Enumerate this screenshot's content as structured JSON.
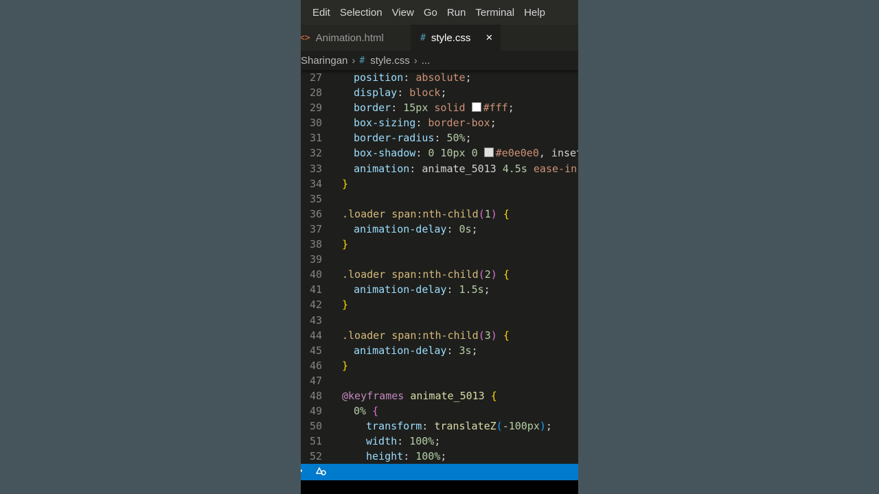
{
  "menu": [
    "Edit",
    "Selection",
    "View",
    "Go",
    "Run",
    "Terminal",
    "Help"
  ],
  "tabs": {
    "inactive": {
      "label": "Animation.html",
      "icon": "html-icon"
    },
    "active": {
      "label": "style.css",
      "icon": "css-hash-icon"
    },
    "close": "×"
  },
  "breadcrumb": {
    "folder": "Sharingan",
    "file": "style.css",
    "more": "..."
  },
  "colors": {
    "swatch_white": "#ffffff",
    "swatch_light": "#e0e0e0",
    "status": "#007acc"
  },
  "code": {
    "l27": {
      "n": "27",
      "prop": "position",
      "val": "absolute"
    },
    "l28": {
      "n": "28",
      "prop": "display",
      "val": "block"
    },
    "l29": {
      "n": "29",
      "prop": "border",
      "num": "15px",
      "kw": "solid",
      "col": "#fff"
    },
    "l30": {
      "n": "30",
      "prop": "box-sizing",
      "val": "border-box"
    },
    "l31": {
      "n": "31",
      "prop": "border-radius",
      "val": "50%"
    },
    "l32": {
      "n": "32",
      "prop": "box-shadow",
      "nums": "0 10px 0",
      "col": "#e0e0e0",
      "rest": ", inset"
    },
    "l33": {
      "n": "33",
      "prop": "animation",
      "name": "animate_5013",
      "num": "4.5s",
      "rest": "ease-in-"
    },
    "l34": {
      "n": "34"
    },
    "l35": {
      "n": "35"
    },
    "l36": {
      "n": "36",
      "sel": ".loader span:nth-child",
      "arg": "1"
    },
    "l37": {
      "n": "37",
      "prop": "animation-delay",
      "val": "0s"
    },
    "l38": {
      "n": "38"
    },
    "l39": {
      "n": "39"
    },
    "l40": {
      "n": "40",
      "sel": ".loader span:nth-child",
      "arg": "2"
    },
    "l41": {
      "n": "41",
      "prop": "animation-delay",
      "val": "1.5s"
    },
    "l42": {
      "n": "42"
    },
    "l43": {
      "n": "43"
    },
    "l44": {
      "n": "44",
      "sel": ".loader span:nth-child",
      "arg": "3"
    },
    "l45": {
      "n": "45",
      "prop": "animation-delay",
      "val": "3s"
    },
    "l46": {
      "n": "46"
    },
    "l47": {
      "n": "47"
    },
    "l48": {
      "n": "48",
      "at": "@keyframes",
      "name": "animate_5013"
    },
    "l49": {
      "n": "49",
      "sel": "0%"
    },
    "l50": {
      "n": "50",
      "prop": "transform",
      "fn": "translateZ",
      "arg": "-100px"
    },
    "l51": {
      "n": "51",
      "prop": "width",
      "val": "100%"
    },
    "l52": {
      "n": "52",
      "prop": "height",
      "val": "100%"
    }
  }
}
